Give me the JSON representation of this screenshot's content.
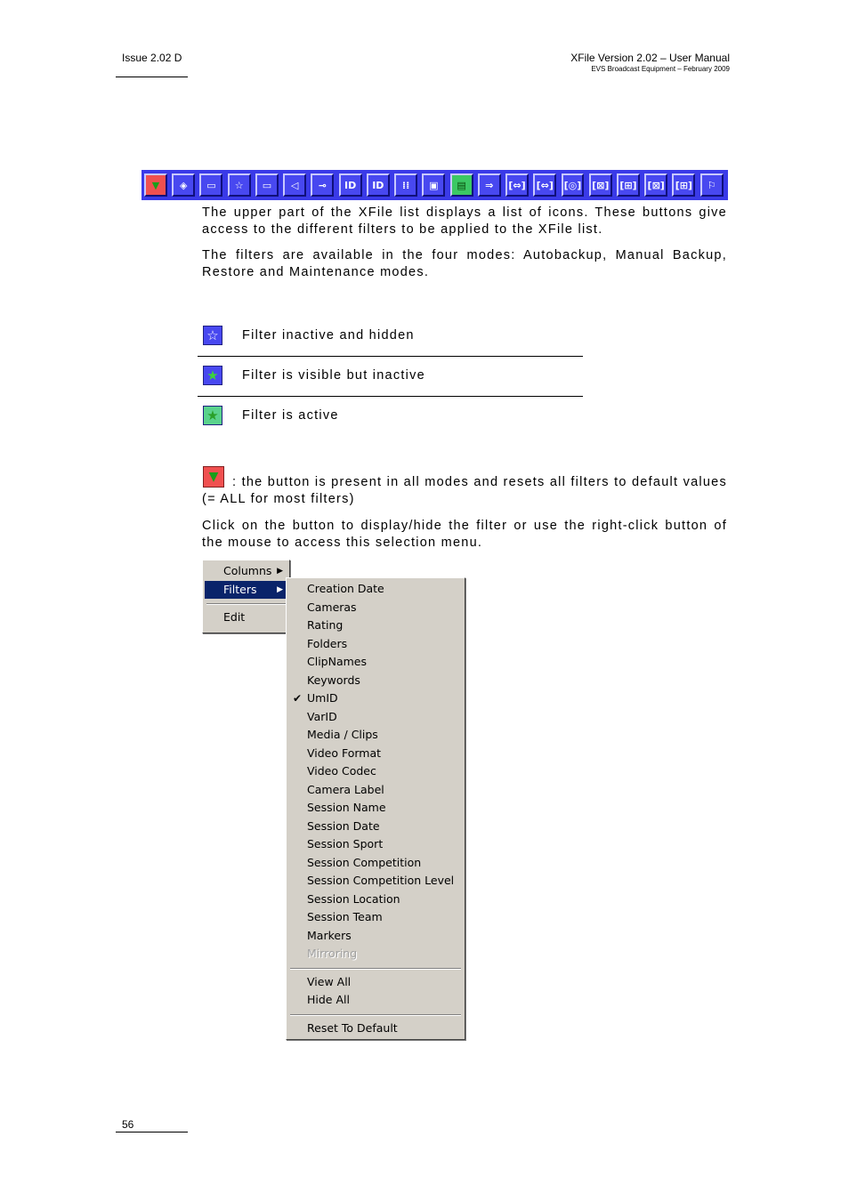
{
  "header": {
    "issue": "Issue 2.02 D",
    "manual_title": "XFile Version 2.02 – User Manual",
    "company_date": "EVS Broadcast Equipment – February 2009"
  },
  "toolbar": {
    "buttons": [
      {
        "icon": "filter-funnel-icon",
        "glyph": "▼"
      },
      {
        "icon": "camera-icon",
        "glyph": "◈"
      },
      {
        "icon": "folder-icon",
        "glyph": "▭"
      },
      {
        "icon": "star-icon",
        "glyph": "☆"
      },
      {
        "icon": "folder-open-icon",
        "glyph": "▭"
      },
      {
        "icon": "tag-icon",
        "glyph": "◁"
      },
      {
        "icon": "key-icon",
        "glyph": "⊸"
      },
      {
        "icon": "id-icon",
        "glyph": "ID"
      },
      {
        "icon": "id-icon",
        "glyph": "ID"
      },
      {
        "icon": "grid-icon",
        "glyph": "⁞⁞"
      },
      {
        "icon": "media-icon",
        "glyph": "▣"
      },
      {
        "icon": "video-format-icon",
        "glyph": "▤"
      },
      {
        "icon": "video-codec-icon",
        "glyph": "⇒"
      },
      {
        "icon": "camera-label-icon",
        "glyph": "[⇔]"
      },
      {
        "icon": "session-name-icon",
        "glyph": "[⇔]"
      },
      {
        "icon": "session-date-icon",
        "glyph": "[◎]"
      },
      {
        "icon": "session-sport-icon",
        "glyph": "[⊠]"
      },
      {
        "icon": "session-competition-icon",
        "glyph": "[⊞]"
      },
      {
        "icon": "session-location-icon",
        "glyph": "[⊠]"
      },
      {
        "icon": "session-team-icon",
        "glyph": "[⊞]"
      },
      {
        "icon": "flag-icon",
        "glyph": "⚐"
      }
    ]
  },
  "intro": {
    "p1": "The upper part of the XFile list displays a list of icons. These buttons give access to the different filters to be applied to the XFile list.",
    "p2": "The filters are available in the four modes: Autobackup, Manual Backup, Restore and Maintenance modes."
  },
  "legend": [
    {
      "label": "Filter inactive and hidden",
      "icon": "star-outline-icon",
      "bg": "#4848f0",
      "star_color": "#ffffff"
    },
    {
      "label": "Filter is visible but inactive",
      "icon": "star-green-icon",
      "bg": "#4848f0",
      "star_color": "#3cd23c"
    },
    {
      "label": "Filter is active",
      "icon": "star-active-icon",
      "bg": "#5ad28c",
      "star_color": "#2aa02a"
    }
  ],
  "reset": {
    "line1": ": the button is present in all modes and resets all filters to default values (= ALL for most filters)"
  },
  "click_para": "Click on the button to display/hide the filter or use the right-click button of the mouse to access this selection menu.",
  "context_menu": {
    "main": [
      {
        "label": "Columns",
        "submenu": true
      },
      {
        "label": "Filters",
        "submenu": true,
        "selected": true
      },
      {
        "label": "Edit"
      }
    ],
    "arrow": "▶",
    "check": "✔",
    "sub_group1": [
      {
        "label": "Creation Date"
      },
      {
        "label": "Cameras"
      },
      {
        "label": "Rating"
      },
      {
        "label": "Folders"
      },
      {
        "label": "ClipNames"
      },
      {
        "label": "Keywords"
      },
      {
        "label": "UmID",
        "checked": true
      },
      {
        "label": "VarID"
      },
      {
        "label": "Media / Clips"
      },
      {
        "label": "Video Format"
      },
      {
        "label": "Video Codec"
      },
      {
        "label": "Camera Label"
      },
      {
        "label": "Session Name"
      },
      {
        "label": "Session Date"
      },
      {
        "label": "Session Sport"
      },
      {
        "label": "Session Competition"
      },
      {
        "label": "Session Competition Level"
      },
      {
        "label": "Session Location"
      },
      {
        "label": "Session Team"
      },
      {
        "label": "Markers"
      },
      {
        "label": "Mirroring",
        "disabled": true
      }
    ],
    "sub_group2": [
      {
        "label": "View All"
      },
      {
        "label": "Hide All"
      }
    ],
    "sub_group3": [
      {
        "label": "Reset To Default"
      }
    ]
  },
  "footer": {
    "page_number": "56"
  }
}
